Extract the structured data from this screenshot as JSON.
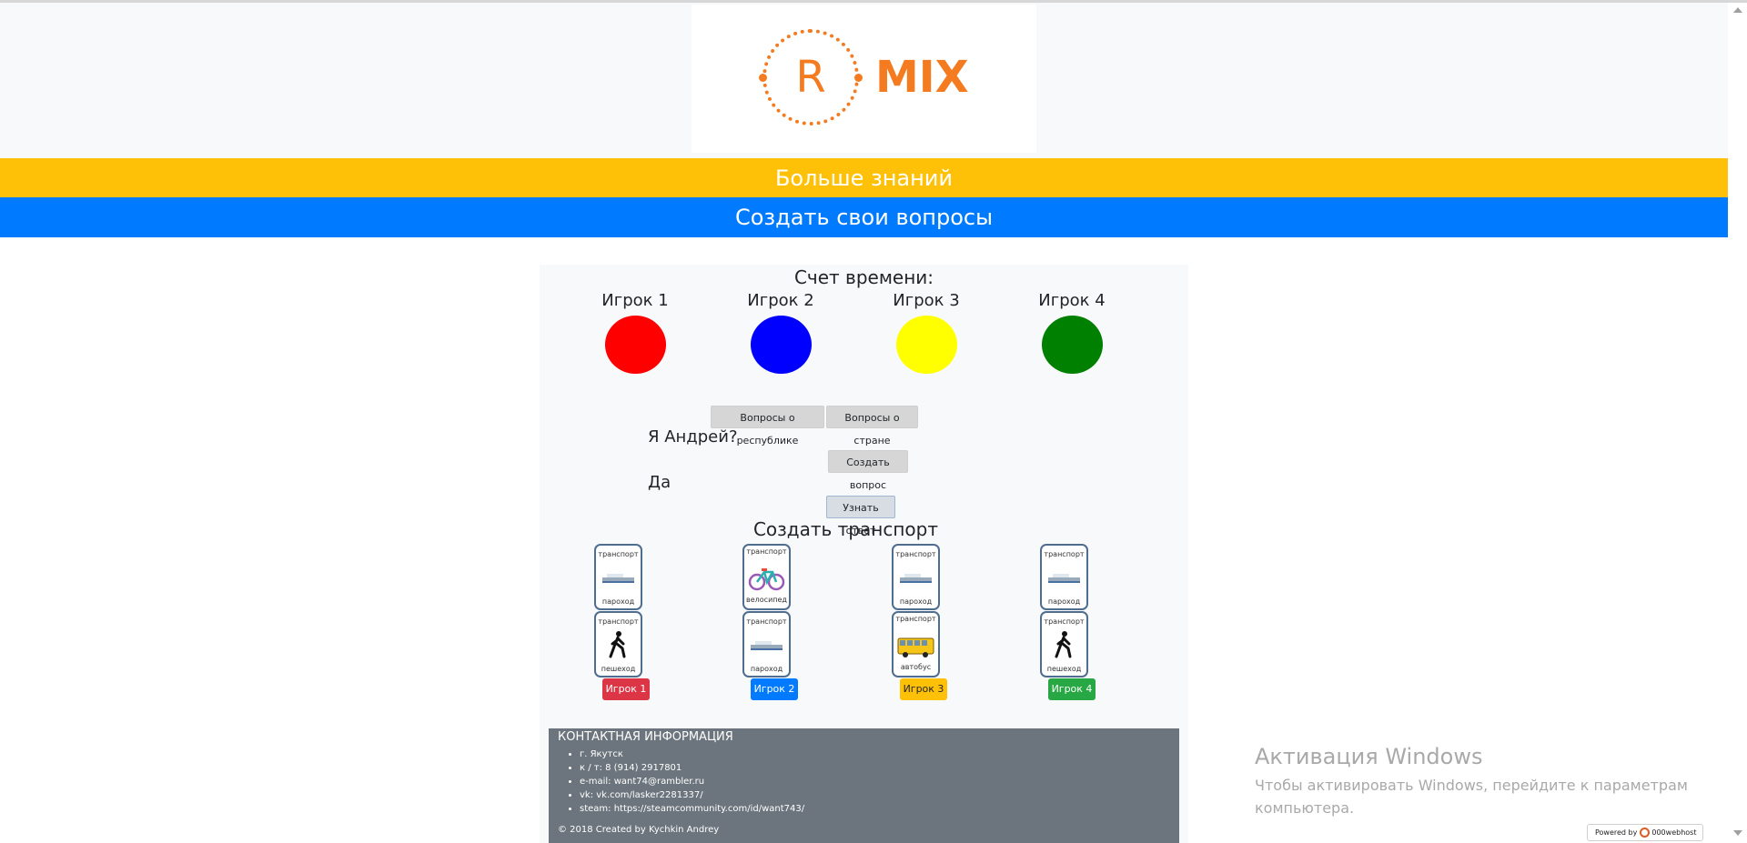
{
  "header": {
    "logo_letter": "R",
    "logo_text": "MIX",
    "logo_color": "#f47b20"
  },
  "nav": {
    "more_knowledge": "Больше знаний",
    "create_questions": "Создать свои вопросы",
    "yellow": "#ffc107",
    "blue": "#007bff"
  },
  "timer": {
    "title": "Счет времени:"
  },
  "players": [
    {
      "label": "Игрок 1",
      "color": "#ff0000"
    },
    {
      "label": "Игрок 2",
      "color": "#0000ff"
    },
    {
      "label": "Игрок 3",
      "color": "#ffff00"
    },
    {
      "label": "Игрок 4",
      "color": "#008000"
    }
  ],
  "questions": {
    "republic_button": "Вопросы о республике",
    "country_button": "Вопросы о стране",
    "question_text": "Я Андрей?",
    "create_button": "Создать вопрос",
    "answer_text": "Да",
    "reveal_button": "Узнать ответ"
  },
  "transport": {
    "title": "Создать транспорт",
    "card_header": "транспорт",
    "columns": [
      {
        "top": "пароход",
        "bottom": "пешеход",
        "button": "Игрок 1",
        "button_color": "#dc3545",
        "icons": [
          "ship-icon",
          "pedestrian-icon"
        ]
      },
      {
        "top": "велосипед",
        "bottom": "пароход",
        "button": "Игрок 2",
        "button_color": "#007bff",
        "icons": [
          "bicycle-icon",
          "ship-icon"
        ]
      },
      {
        "top": "пароход",
        "bottom": "автобус",
        "button": "Игрок 3",
        "button_color": "#ffc107",
        "icons": [
          "ship-icon",
          "bus-icon"
        ]
      },
      {
        "top": "пароход",
        "bottom": "пешеход",
        "button": "Игрок 4",
        "button_color": "#28a745",
        "icons": [
          "ship-icon",
          "pedestrian-icon"
        ]
      }
    ]
  },
  "footer": {
    "title": "КОНТАКТНАЯ ИНФОРМАЦИЯ",
    "items": [
      "г. Якутск",
      "к / т: 8 (914) 2917801",
      "e-mail: want74@rambler.ru",
      "vk: vk.com/lasker2281337/",
      "steam: https://steamcommunity.com/id/want743/"
    ],
    "copyright": "© 2018 Created by Kychkin Andrey"
  },
  "windows_watermark": {
    "title": "Активация Windows",
    "subtitle": "Чтобы активировать Windows, перейдите к параметрам компьютера."
  },
  "powered": {
    "label": "Powered by",
    "brand": "000webhost"
  }
}
